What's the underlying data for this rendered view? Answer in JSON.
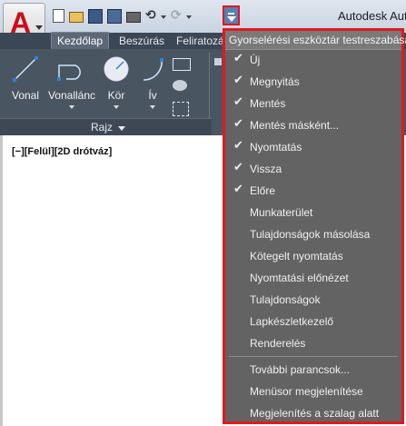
{
  "titlebar": {
    "app_title": "Autodesk Autoc",
    "app_letter": "A",
    "undo_glyph": "⟲",
    "redo_glyph": "⟳"
  },
  "ribbon": {
    "tabs": [
      "Kezdőlap",
      "Beszúrás",
      "Feliratozás"
    ],
    "tools": [
      "Vonal",
      "Vonallánc",
      "Kör",
      "Ív"
    ],
    "group_label": "Rajz"
  },
  "viewport": {
    "label": "[−][Felül][2D drótváz]"
  },
  "menu": {
    "title": "Gyorselérési eszköztár testreszabása",
    "checkmark": "✔",
    "items": [
      {
        "label": "Új",
        "checked": true
      },
      {
        "label": "Megnyitás",
        "checked": true
      },
      {
        "label": "Mentés",
        "checked": true
      },
      {
        "label": "Mentés másként...",
        "checked": true
      },
      {
        "label": "Nyomtatás",
        "checked": true
      },
      {
        "label": "Vissza",
        "checked": true
      },
      {
        "label": "Előre",
        "checked": true
      },
      {
        "label": "Munkaterület",
        "checked": false
      },
      {
        "label": "Tulajdonságok másolása",
        "checked": false
      },
      {
        "label": "Kötegelt nyomtatás",
        "checked": false
      },
      {
        "label": "Nyomtatási előnézet",
        "checked": false
      },
      {
        "label": "Tulajdonságok",
        "checked": false
      },
      {
        "label": "Lapkészletkezelő",
        "checked": false
      },
      {
        "label": "Renderelés",
        "checked": false
      }
    ],
    "extra_items": [
      "További parancsok...",
      "Menüsor megjelenítése",
      "Megjelenítés a szalag alatt"
    ]
  },
  "colors": {
    "highlight_border": "#e01a1e",
    "menu_bg": "#636363",
    "ribbon_bg": "#4a5562"
  }
}
